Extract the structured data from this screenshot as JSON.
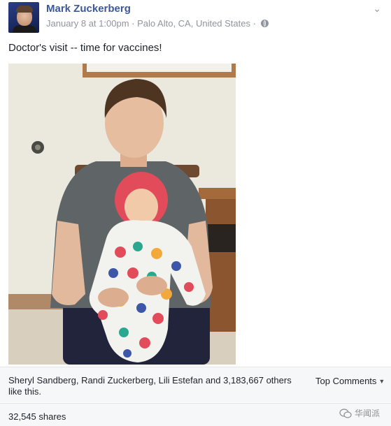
{
  "post": {
    "author": "Mark Zuckerberg",
    "timestamp": "January 8 at 1:00pm",
    "separator": "·",
    "location": "Palo Alto, CA, United States",
    "privacy_icon": "globe-icon",
    "text": "Doctor's visit -- time for vaccines!"
  },
  "engagement": {
    "likes_text": "Sheryl Sandberg, Randi Zuckerberg, Lili Estefan and 3,183,667 others like this.",
    "top_comments_label": "Top Comments",
    "shares_text": "32,545 shares"
  },
  "watermark": {
    "text": "华闻派",
    "icon": "wechat-icon"
  },
  "colors": {
    "author_link": "#3b5998",
    "meta_gray": "#90949c",
    "bar_background": "#f6f7f9"
  }
}
